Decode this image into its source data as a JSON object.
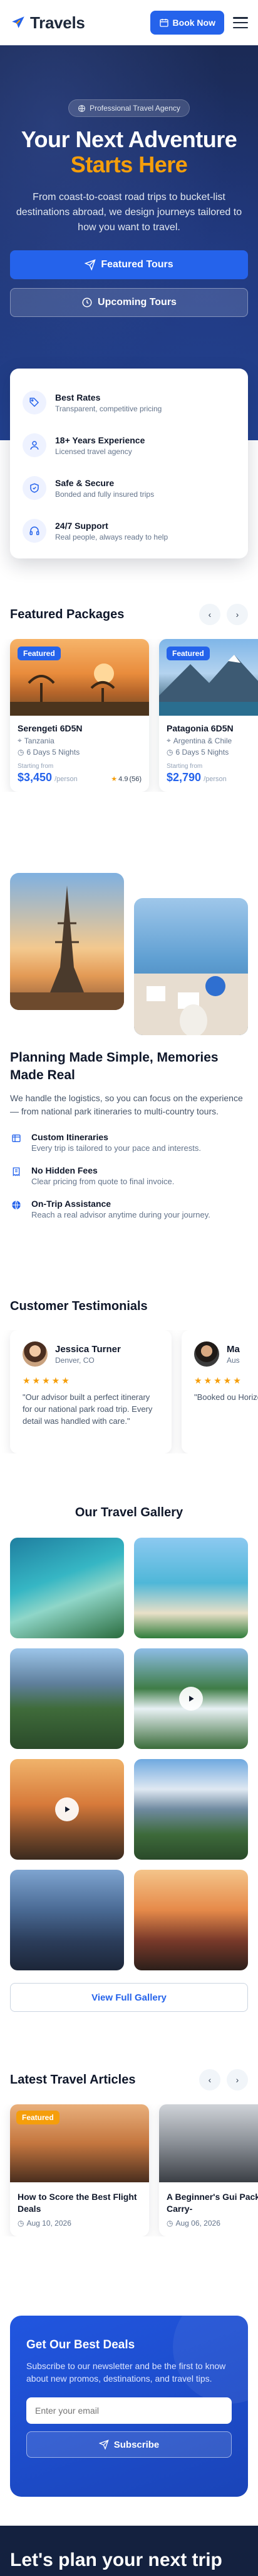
{
  "brand": {
    "name": "Travels"
  },
  "header": {
    "book_label": "Book Now"
  },
  "hero": {
    "badge": "Professional Travel Agency",
    "title_line1": "Your Next Adventure",
    "title_line2": "Starts Here",
    "description": "From coast-to-coast road trips to bucket-list destinations abroad, we design journeys tailored to how you want to travel.",
    "primary_cta": "Featured Tours",
    "secondary_cta": "Upcoming Tours"
  },
  "features": [
    {
      "icon": "tag-icon",
      "title": "Best Rates",
      "desc": "Transparent, competitive pricing"
    },
    {
      "icon": "person-icon",
      "title": "18+ Years Experience",
      "desc": "Licensed travel agency"
    },
    {
      "icon": "shield-icon",
      "title": "Safe & Secure",
      "desc": "Bonded and fully insured trips"
    },
    {
      "icon": "headset-icon",
      "title": "24/7 Support",
      "desc": "Real people, always ready to help"
    }
  ],
  "packages": {
    "title": "Featured Packages",
    "items": [
      {
        "badge": "Featured",
        "name": "Serengeti 6D5N",
        "location": "Tanzania",
        "duration": "6 Days 5 Nights",
        "from_label": "Starting from",
        "price": "$3,450",
        "per": "/person",
        "rating": "4.9",
        "reviews": "(56)"
      },
      {
        "badge": "Featured",
        "name": "Patagonia 6D5N",
        "location": "Argentina & Chile",
        "duration": "6 Days 5 Nights",
        "from_label": "Starting from",
        "price": "$2,790",
        "per": "/person",
        "rating": "",
        "reviews": ""
      }
    ]
  },
  "planning": {
    "title": "Planning Made Simple, Memories Made Real",
    "description": "We handle the logistics, so you can focus on the experience — from national park itineraries to multi-country tours.",
    "items": [
      {
        "icon": "itinerary-icon",
        "title": "Custom Itineraries",
        "desc": "Every trip is tailored to your pace and interests."
      },
      {
        "icon": "receipt-icon",
        "title": "No Hidden Fees",
        "desc": "Clear pricing from quote to final invoice."
      },
      {
        "icon": "globe-icon",
        "title": "On-Trip Assistance",
        "desc": "Reach a real advisor anytime during your journey."
      }
    ]
  },
  "testimonials": {
    "title": "Customer Testimonials",
    "items": [
      {
        "name": "Jessica Turner",
        "location": "Denver, CO",
        "stars": "★★★★★",
        "quote": "\"Our advisor built a perfect itinerary for our national park road trip. Every detail was handled with care.\""
      },
      {
        "name": "Ma",
        "location": "Aus",
        "stars": "★★★★★",
        "quote": "\"Booked ou Horizon and from flights"
      }
    ]
  },
  "gallery": {
    "title": "Our Travel Gallery",
    "view_all": "View Full Gallery"
  },
  "articles": {
    "title": "Latest Travel Articles",
    "items": [
      {
        "badge": "Featured",
        "title": "How to Score the Best Flight Deals",
        "date": "Aug 10, 2026"
      },
      {
        "badge": "",
        "title": "A Beginner's Gui Packing a Carry-",
        "date": "Aug 06, 2026"
      }
    ]
  },
  "newsletter": {
    "title": "Get Our Best Deals",
    "description": "Subscribe to our newsletter and be the first to know about new promos, destinations, and travel tips.",
    "placeholder": "Enter your email",
    "button": "Subscribe"
  },
  "footer": {
    "heading": "Let's plan your next trip"
  },
  "colors": {
    "accent": "#2563eb",
    "highlight": "#f59e0b",
    "hero_bg": "#1e3370"
  }
}
